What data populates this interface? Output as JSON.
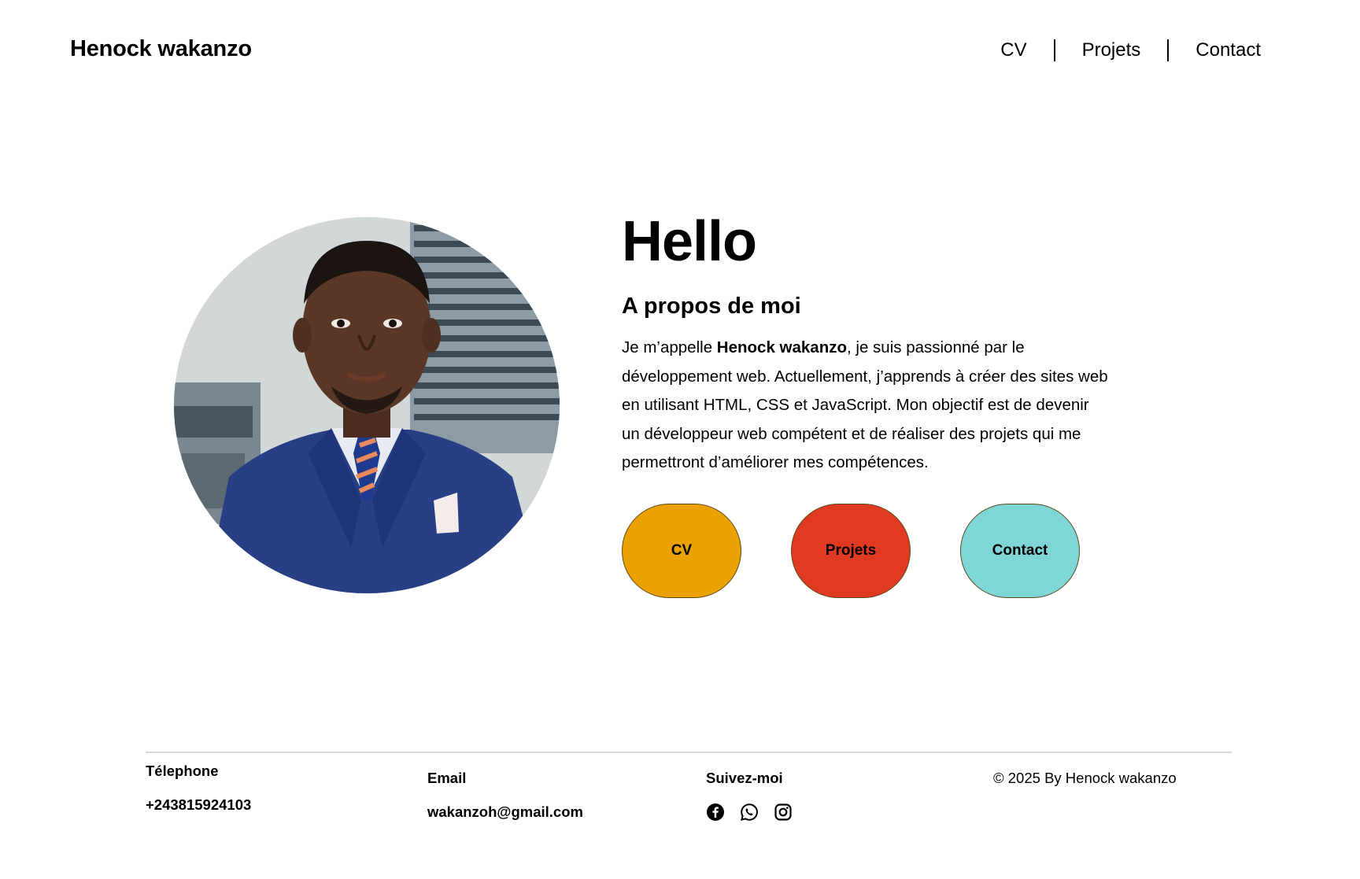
{
  "header": {
    "brand": "Henock wakanzo",
    "nav": [
      {
        "label": "CV"
      },
      {
        "label": "Projets"
      },
      {
        "label": "Contact"
      }
    ]
  },
  "hero": {
    "hello": "Hello",
    "about_title": "A propos de moi",
    "about_intro": "Je m’appelle ",
    "about_name": "Henock wakanzo",
    "about_rest": ",  je suis passionné par le développement web. Actuellement, j’apprends à créer des sites web en utilisant HTML, CSS et JavaScript. Mon objectif est de devenir un développeur web compétent et de réaliser des projets qui me permettront d’améliorer mes compétences.",
    "buttons": [
      {
        "label": "CV",
        "color": "#EBA100"
      },
      {
        "label": "Projets",
        "color": "#E03A22"
      },
      {
        "label": "Contact",
        "color": "#7FD6D6"
      }
    ]
  },
  "footer": {
    "phone_title": "Télephone",
    "phone_value": "+243815924103",
    "email_title": "Email",
    "email_value": "wakanzoh@gmail.com",
    "follow_title": "Suivez-moi",
    "social_icons": [
      "facebook-icon",
      "whatsapp-icon",
      "instagram-icon"
    ],
    "copyright": "© 2025 By Henock  wakanzo"
  }
}
